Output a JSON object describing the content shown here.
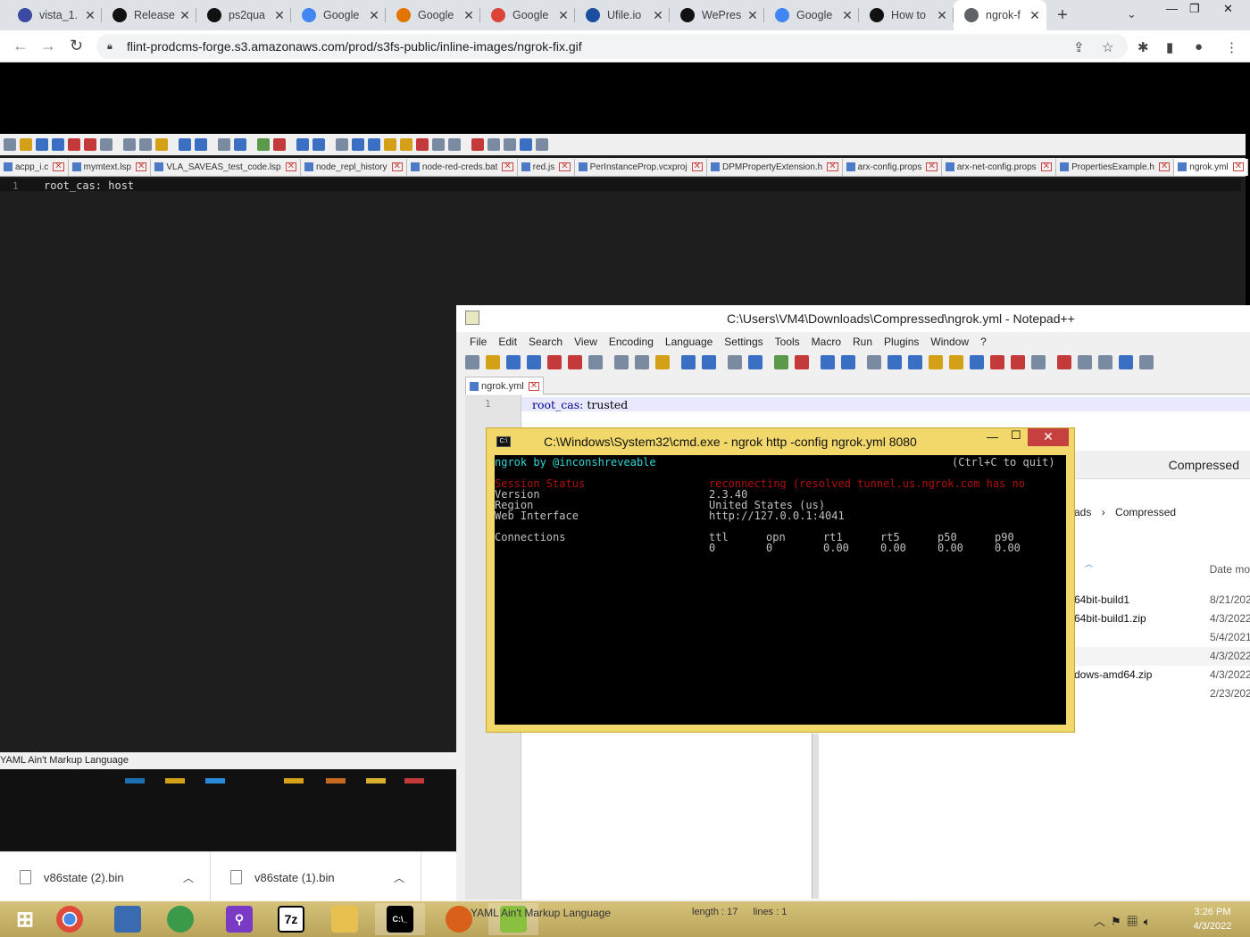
{
  "browser": {
    "tabs": [
      {
        "title": "vista_1.",
        "icon": "app-icon",
        "color": "#3b4aa0"
      },
      {
        "title": "Release",
        "icon": "github-icon",
        "color": "#111111"
      },
      {
        "title": "ps2qua",
        "icon": "github-icon",
        "color": "#111111"
      },
      {
        "title": "Google",
        "icon": "google-icon",
        "color": "#4285f4"
      },
      {
        "title": "Google",
        "icon": "infinity-icon",
        "color": "#e37400"
      },
      {
        "title": "Google",
        "icon": "drive-icon",
        "color": "#db4437"
      },
      {
        "title": "Ufile.io",
        "icon": "ufile-icon",
        "color": "#1a4fa0"
      },
      {
        "title": "WePres",
        "icon": "we-icon",
        "color": "#111111"
      },
      {
        "title": "Google",
        "icon": "google-icon",
        "color": "#4285f4"
      },
      {
        "title": "How to",
        "icon": "swoosh-icon",
        "color": "#111111"
      },
      {
        "title": "ngrok-f",
        "icon": "globe-icon",
        "color": "#5f6368"
      }
    ],
    "new_tab": "+",
    "url": "flint-prodcms-forge.s3.amazonaws.com/prod/s3fs-public/inline-images/ngrok-fix.gif"
  },
  "np_back": {
    "file_tabs": [
      "acpp_i.c",
      "mymtext.lsp",
      "VLA_SAVEAS_test_code.lsp",
      "node_repl_history",
      "node-red-creds.bat",
      "red.js",
      "PerInstanceProp.vcxproj",
      "DPMPropertyExtension.h",
      "arx-config.props",
      "arx-net-config.props",
      "PropertiesExample.h",
      "ngrok.yml"
    ],
    "line_number": "1",
    "code": "root_cas: host",
    "status": "YAML Ain't Markup Language"
  },
  "downloads": [
    {
      "name": "v86state (2).bin"
    },
    {
      "name": "v86state (1).bin"
    }
  ],
  "np_front": {
    "title": "C:\\Users\\VM4\\Downloads\\Compressed\\ngrok.yml - Notepad++",
    "menu": [
      "File",
      "Edit",
      "Search",
      "View",
      "Encoding",
      "Language",
      "Settings",
      "Tools",
      "Macro",
      "Run",
      "Plugins",
      "Window",
      "?"
    ],
    "file_tab": "ngrok.yml",
    "line_number": "1",
    "code_key": "root_cas:",
    "code_value": "trusted"
  },
  "explorer": {
    "header": "Compressed",
    "crumb_a": "ads",
    "crumb_sep": "›",
    "crumb_b": "Compressed",
    "date_col": "Date mo",
    "rows": [
      {
        "name": "64bit-build1",
        "date": "8/21/202"
      },
      {
        "name": "64bit-build1.zip",
        "date": "4/3/2022"
      },
      {
        "name": "",
        "date": "5/4/2021"
      },
      {
        "name": "",
        "date": "4/3/2022"
      },
      {
        "name": "dows-amd64.zip",
        "date": "4/3/2022"
      },
      {
        "name": "",
        "date": "2/23/202"
      }
    ]
  },
  "cmd": {
    "title": "C:\\Windows\\System32\\cmd.exe - ngrok  http -config ngrok.yml 8080",
    "minimize": "—",
    "maximize": "☐",
    "close": "✕",
    "brand": "ngrok by @inconshreveable",
    "quit_hint": "(Ctrl+C to quit)",
    "session_label": "Session Status",
    "session_value": "reconnecting (resolved tunnel.us.ngrok.com has no",
    "version_label": "Version",
    "version_value": "2.3.40",
    "region_label": "Region",
    "region_value": "United States (us)",
    "web_label": "Web Interface",
    "web_value": "http://127.0.0.1:4041",
    "connections_label": "Connections",
    "conn_headers": [
      "ttl",
      "opn",
      "rt1",
      "rt5",
      "p50",
      "p90"
    ],
    "conn_values": [
      "0",
      "0",
      "0.00",
      "0.00",
      "0.00",
      "0.00"
    ]
  },
  "taskbar": {
    "status_left": "YAML Ain't Markup Language",
    "status_length": "length : 17",
    "status_lines": "lines : 1",
    "time": "3:26 PM",
    "date": "4/3/2022"
  }
}
